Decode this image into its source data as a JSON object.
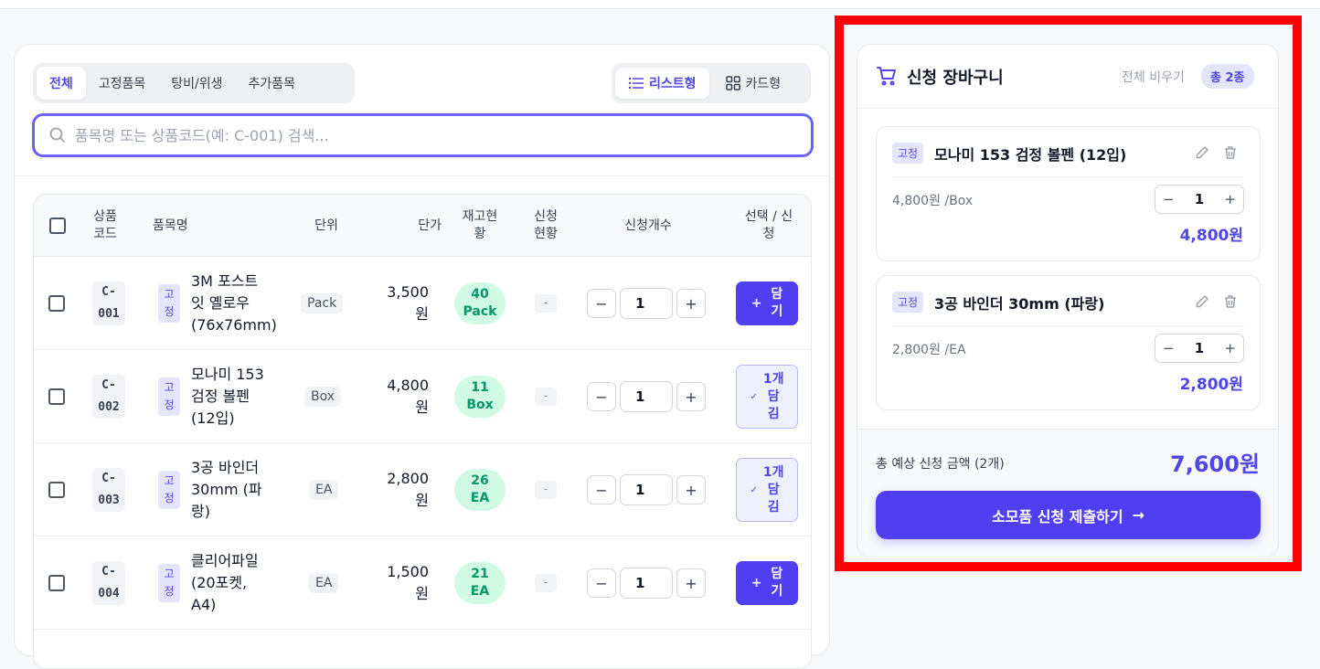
{
  "tabs": [
    "전체",
    "고정품목",
    "탕비/위생",
    "추가품목"
  ],
  "view_toggle": {
    "list": "리스트형",
    "card": "카드형"
  },
  "search": {
    "placeholder": "품목명 또는 상품코드(예: C-001) 검색..."
  },
  "table": {
    "headers": {
      "code": "상품\n코드",
      "name": "품목명",
      "unit": "단위",
      "price": "단가",
      "stock": "재고현\n황",
      "status": "신청\n현황",
      "qty": "신청개수",
      "action": "선택 / 신\n청"
    },
    "rows": [
      {
        "code": "C-\n001",
        "badge": "고\n정",
        "name": "3M 포스트\n잇 옐로우\n(76x76mm)",
        "unit": "Pack",
        "price": "3,500\n원",
        "stock": "40\nPack",
        "status": "-",
        "qty": "1",
        "minus": "−",
        "plus": "+",
        "action_icon": "+",
        "action_label": "담\n기"
      },
      {
        "code": "C-\n002",
        "badge": "고\n정",
        "name": "모나미 153\n검정 볼펜\n(12입)",
        "unit": "Box",
        "price": "4,800\n원",
        "stock": "11\nBox",
        "status": "-",
        "qty": "1",
        "minus": "−",
        "plus": "+",
        "action_icon": "✓",
        "action_label": "1개\n담\n김"
      },
      {
        "code": "C-\n003",
        "badge": "고\n정",
        "name": "3공 바인더\n30mm (파\n랑)",
        "unit": "EA",
        "price": "2,800\n원",
        "stock": "26\nEA",
        "status": "-",
        "qty": "1",
        "minus": "−",
        "plus": "+",
        "action_icon": "✓",
        "action_label": "1개\n담\n김"
      },
      {
        "code": "C-\n004",
        "badge": "고\n정",
        "name": "클리어파일\n(20포켓,\nA4)",
        "unit": "EA",
        "price": "1,500\n원",
        "stock": "21\nEA",
        "status": "-",
        "qty": "1",
        "minus": "−",
        "plus": "+",
        "action_icon": "+",
        "action_label": "담\n기"
      }
    ]
  },
  "cart": {
    "title": "신청 장바구니",
    "clear_all": "전체 비우기",
    "count_badge": "총 2종",
    "items": [
      {
        "badge": "고정",
        "name": "모나미 153 검정 볼펜 (12입)",
        "unit_price": "4,800원 /Box",
        "qty": "1",
        "minus": "−",
        "plus": "+",
        "total": "4,800원"
      },
      {
        "badge": "고정",
        "name": "3공 바인더 30mm (파랑)",
        "unit_price": "2,800원 /EA",
        "qty": "1",
        "minus": "−",
        "plus": "+",
        "total": "2,800원"
      }
    ],
    "total_label": "총 예상 신청 금액 (2개)",
    "total_value": "7,600원",
    "submit_label": "소모품 신청 제출하기",
    "submit_arrow": "→"
  },
  "colors": {
    "accent": "#4f3ff0",
    "highlight": "#ff0000",
    "stock_bg": "#d1fae5",
    "stock_text": "#059669"
  },
  "icons": {
    "search": "search-icon",
    "list": "list-icon",
    "grid": "grid-icon",
    "cart": "cart-icon",
    "edit": "pencil-icon",
    "delete": "trash-icon"
  }
}
